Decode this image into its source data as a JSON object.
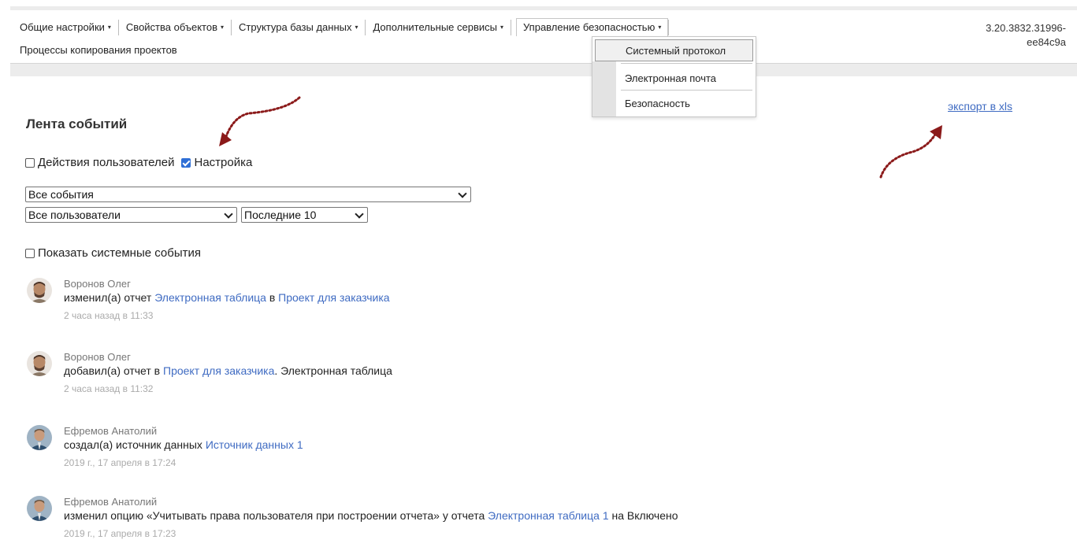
{
  "menu": {
    "items": [
      {
        "label": "Общие настройки",
        "caret": "▾"
      },
      {
        "label": "Свойства объектов",
        "caret": "▾"
      },
      {
        "label": "Структура базы данных",
        "caret": "▾"
      },
      {
        "label": "Дополнительные сервисы",
        "caret": "▾"
      },
      {
        "label": "Управление безопасностью",
        "caret": "▾"
      }
    ],
    "row2": "Процессы копирования проектов",
    "version_line1": "3.20.3832.31996-",
    "version_line2": "ee84c9a"
  },
  "dropdown": {
    "items": [
      "Системный протокол",
      "Электронная почта",
      "Безопасность"
    ]
  },
  "feed": {
    "title": "Лента событий",
    "export_link": "экспорт в xls",
    "filter_user_actions": {
      "label": "Действия пользователей",
      "checked": false
    },
    "filter_settings": {
      "label": "Настройка",
      "checked": true
    },
    "event_select": "Все события",
    "user_select": "Все пользователи",
    "count_select": "Последние 10",
    "system_events": {
      "label": "Показать системные события",
      "checked": false
    }
  },
  "events": [
    {
      "author": "Воронов Олег",
      "parts": [
        "изменил(а) отчет ",
        "Электронная таблица",
        " в ",
        "Проект для заказчика",
        ""
      ],
      "time": "2 часа назад в 11:33"
    },
    {
      "author": "Воронов Олег",
      "parts": [
        "добавил(а) отчет в ",
        "Проект для заказчика",
        ". Электронная таблица"
      ],
      "time": "2 часа назад в 11:32"
    },
    {
      "author": "Ефремов Анатолий",
      "parts": [
        "создал(а) источник данных ",
        "Источник данных 1"
      ],
      "time": "2019 г., 17 апреля в 17:24"
    },
    {
      "author": "Ефремов Анатолий",
      "parts": [
        "изменил опцию «Учитывать права пользователя при построении отчета» у отчета ",
        "Электронная таблица 1",
        " на Включено"
      ],
      "time": "2019 г., 17 апреля в 17:23"
    }
  ],
  "colors": {
    "link": "#3f6bc2",
    "checkbox_on": "#2f6fd6",
    "arrow": "#8b1a1a"
  }
}
